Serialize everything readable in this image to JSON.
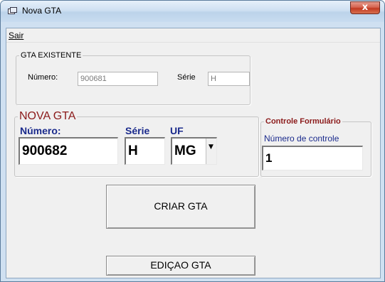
{
  "window": {
    "title": "Nova GTA",
    "close_label": "x"
  },
  "menu": {
    "items": [
      {
        "label": "Sair"
      }
    ]
  },
  "gta_existente": {
    "legend": "GTA EXISTENTE",
    "numero_label": "Número:",
    "numero_value": "900681",
    "serie_label": "Série",
    "serie_value": "H"
  },
  "nova_gta": {
    "legend": "NOVA GTA",
    "numero_label": "Número:",
    "numero_value": "900682",
    "serie_label": "Série",
    "serie_value": "H",
    "uf_label": "UF",
    "uf_value": "MG"
  },
  "controle": {
    "legend": "Controle Formulário",
    "numero_label": "Número de controle",
    "numero_value": "1"
  },
  "buttons": {
    "criar": "CRIAR GTA",
    "edicao": "EDIÇAO GTA"
  },
  "colors": {
    "accent_red": "#8b1a1a",
    "accent_blue": "#1a2a8c",
    "title_bar": "#cfe0f1"
  }
}
